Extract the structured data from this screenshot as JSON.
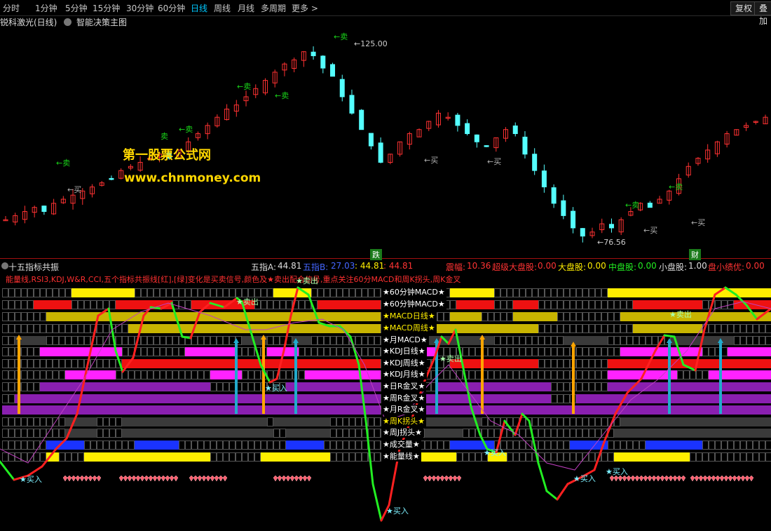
{
  "toolbar": {
    "periods": [
      "分时",
      "1分钟",
      "5分钟",
      "15分钟",
      "30分钟",
      "60分钟",
      "日线",
      "周线",
      "月线",
      "多周期",
      "更多"
    ],
    "active_period": "日线",
    "right_buttons": [
      "复权",
      "叠加"
    ]
  },
  "main_chart": {
    "title": "锐科激光(日线)",
    "indicator": "智能决策主图",
    "price_high": "125.00",
    "price_low": "76.56",
    "watermark_cn": "第一股票公式网",
    "watermark_url": "www.chnmoney.com",
    "buy_tag": "←买",
    "sell_tag": "←卖",
    "small_sell": "卖"
  },
  "period_markers": {
    "die": "跌",
    "cai": "财"
  },
  "sub_panel": {
    "title": "十五指标共振",
    "wz_a_label": "五指A:",
    "wz_a_value": "44.81",
    "wz_b_label": "五指B:",
    "wz_b_value": "27.03",
    "val3": ": 44.81",
    "val4": ": 44.81",
    "amp_label": "震幅:",
    "amp_value": "10.36",
    "super_label": "超级大盘股:",
    "super_value": "0.00",
    "large_label": "大盘股:",
    "large_value": "0.00",
    "mid_label": "中盘股:",
    "mid_value": "0.00",
    "small_label": "小盘股:",
    "small_value": "1.00",
    "excellent_label": "盘小绩优:",
    "excellent_value": "0.00",
    "description": "能量线,RSI3,KDJ,W&R,CCI,五个指标共振线[红],[绿]变化是买卖信号,颜色及★卖出配合信号,重点关注60分MACD和周K拐头,周K金叉",
    "rows": [
      "★60分钟MACD★",
      "★60分钟MACD★",
      "★MACD日线★",
      "★MACD周线★",
      "★月MACD★",
      "★KDJ日线★",
      "★KDJ周线★",
      "★KDJ月线★",
      "★日R金叉★",
      "★周R金叉★",
      "★月R金叉★",
      "★周K拐头★",
      "★周J拐头★",
      "★成交量★",
      "★能量线★"
    ],
    "signal_buy": "★买入",
    "signal_sell": "★卖出"
  },
  "colors": {
    "up": "#ff3232",
    "down": "#54ffff",
    "sell_green": "#19d219",
    "yellow": "#ffee00",
    "red": "#ee1111",
    "olive": "#c8b400",
    "magenta": "#ff22ff",
    "purple": "#8a1fb0",
    "blue": "#1a33ff",
    "gray": "#3a3a3a",
    "line_red": "#ff2020",
    "line_green": "#22ee22",
    "line_thin": "#c040c0"
  },
  "chart_data": {
    "type": "candlestick",
    "price_high": 125.0,
    "price_low": 76.56,
    "close": [
      82,
      83,
      84,
      85,
      84,
      86,
      87,
      88,
      89,
      90,
      91,
      92,
      94,
      95,
      96,
      97,
      98,
      97,
      99,
      101,
      103,
      105,
      107,
      109,
      110,
      112,
      114,
      116,
      118,
      120,
      121,
      123,
      122,
      119,
      117,
      112,
      108,
      104,
      100,
      96,
      98,
      101,
      103,
      104,
      106,
      108,
      107,
      105,
      103,
      101,
      100,
      102,
      104,
      103,
      98,
      94,
      90,
      86,
      83,
      80,
      78,
      79,
      81,
      80,
      82,
      84,
      86,
      85,
      87,
      89,
      92,
      95,
      97,
      99,
      101,
      103,
      104,
      105,
      106,
      107
    ]
  }
}
